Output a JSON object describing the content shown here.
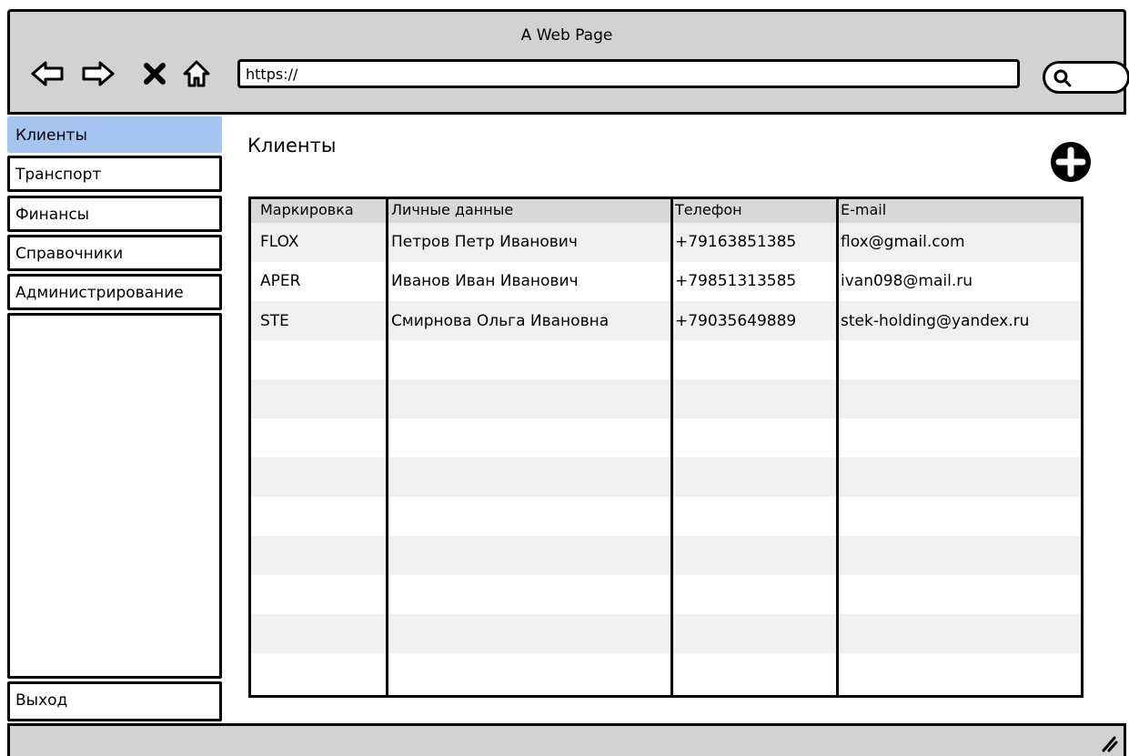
{
  "browser": {
    "title": "A Web Page",
    "url": "https://",
    "nav": {
      "back_icon": "arrow-left-icon",
      "forward_icon": "arrow-right-icon",
      "stop_icon": "close-icon",
      "home_icon": "home-icon",
      "search_icon": "search-icon"
    }
  },
  "sidebar": {
    "items": [
      {
        "label": "Клиенты",
        "active": true
      },
      {
        "label": "Транспорт",
        "active": false
      },
      {
        "label": "Финансы",
        "active": false
      },
      {
        "label": "Справочники",
        "active": false
      },
      {
        "label": "Администрирование",
        "active": false
      }
    ],
    "logout_label": "Выход"
  },
  "main": {
    "title": "Клиенты",
    "add_icon": "plus-circle-icon",
    "table": {
      "columns": [
        "Маркировка",
        "Личные данные",
        "Телефон",
        "E-mail"
      ],
      "rows": [
        [
          "FLOX",
          "Петров Петр Иванович",
          "+79163851385",
          "flox@gmail.com"
        ],
        [
          "APER",
          "Иванов Иван Иванович",
          "+79851313585",
          "ivan098@mail.ru"
        ],
        [
          "STE",
          "Смирнова Ольга Ивановна",
          "+79035649889",
          "stek-holding@yandex.ru"
        ]
      ]
    }
  },
  "colors": {
    "chrome": "#d2d2d2",
    "active_item": "#a6c4f0",
    "row_alt": "#f0f0f0",
    "header_bg": "#d9d9d9"
  }
}
